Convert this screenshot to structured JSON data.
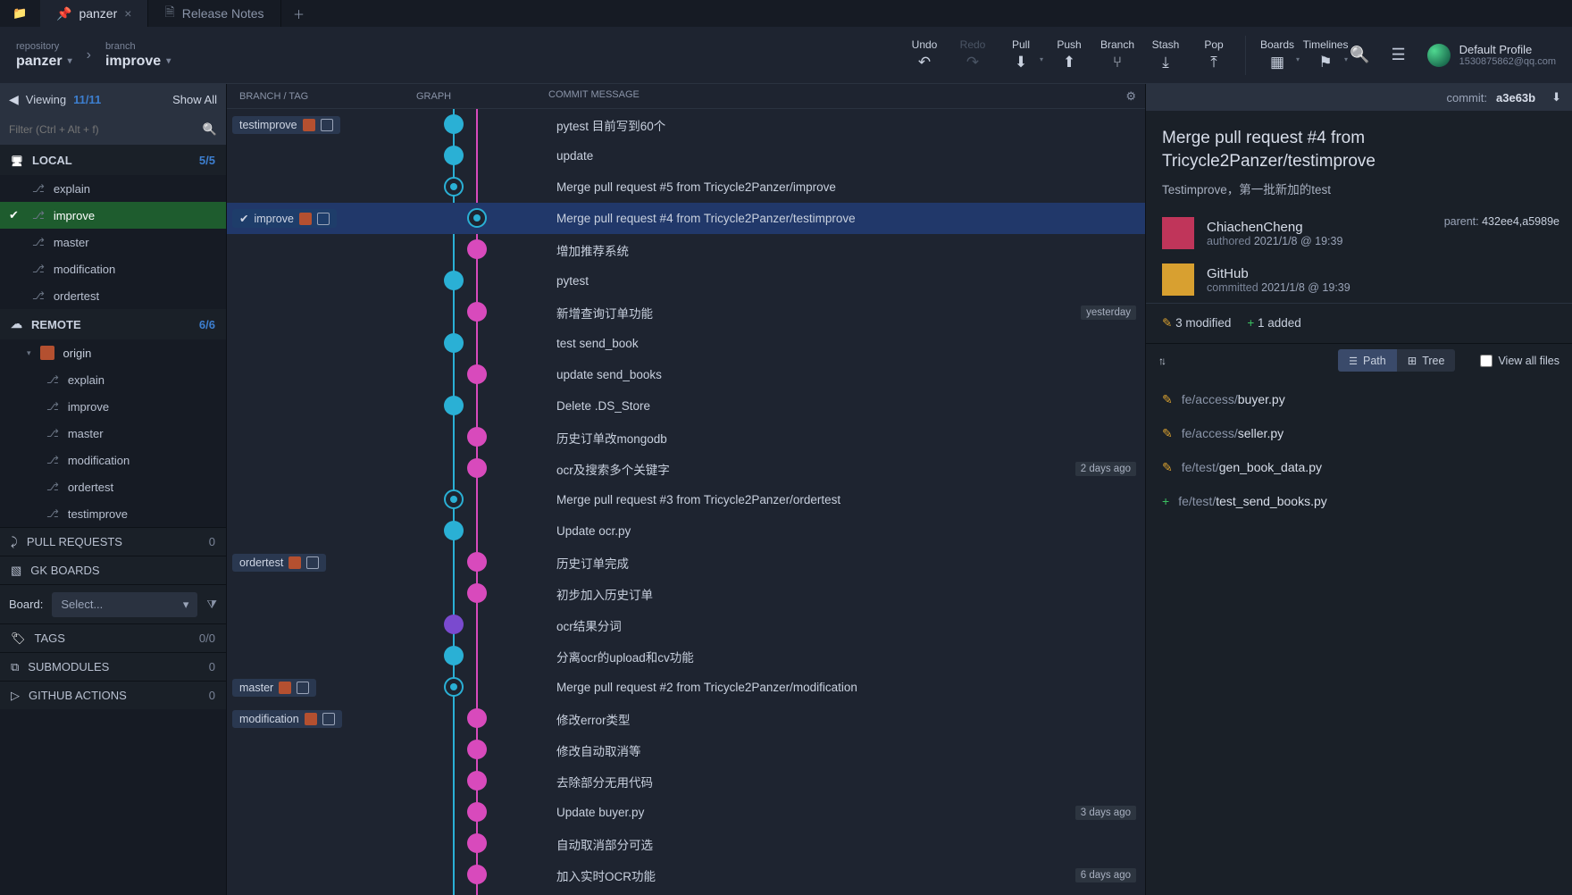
{
  "tabs": {
    "panzer": "panzer",
    "releaseNotes": "Release Notes"
  },
  "repo": {
    "label": "repository",
    "value": "panzer"
  },
  "branch": {
    "label": "branch",
    "value": "improve"
  },
  "actions": {
    "undo": "Undo",
    "redo": "Redo",
    "pull": "Pull",
    "push": "Push",
    "branch": "Branch",
    "stash": "Stash",
    "pop": "Pop",
    "boards": "Boards",
    "timelines": "Timelines"
  },
  "profile": {
    "name": "Default Profile",
    "email": "1530875862@qq.com"
  },
  "sidebar": {
    "viewing": "Viewing",
    "viewingCount": "11/11",
    "showAll": "Show All",
    "filterPlaceholder": "Filter (Ctrl + Alt + f)",
    "local": "LOCAL",
    "localCount": "5/5",
    "localBranches": [
      {
        "name": "explain"
      },
      {
        "name": "improve",
        "active": true
      },
      {
        "name": "master"
      },
      {
        "name": "modification"
      },
      {
        "name": "ordertest"
      }
    ],
    "remote": "REMOTE",
    "remoteCount": "6/6",
    "origin": "origin",
    "remoteBranches": [
      {
        "name": "explain"
      },
      {
        "name": "improve"
      },
      {
        "name": "master"
      },
      {
        "name": "modification"
      },
      {
        "name": "ordertest"
      },
      {
        "name": "testimprove"
      }
    ],
    "pullRequests": "PULL REQUESTS",
    "prCount": "0",
    "gkBoards": "GK BOARDS",
    "boardLabel": "Board:",
    "boardSelect": "Select...",
    "tags": "TAGS",
    "tagsCount": "0/0",
    "submodules": "SUBMODULES",
    "subCount": "0",
    "github": "GITHUB ACTIONS",
    "ghCount": "0"
  },
  "graphHeaders": {
    "branch": "BRANCH  /  TAG",
    "graph": "GRAPH",
    "message": "COMMIT MESSAGE"
  },
  "commits": [
    {
      "tag": "testimprove",
      "msg": "pytest 目前写到60个",
      "rail": 0,
      "type": "av"
    },
    {
      "msg": "update",
      "rail": 0,
      "type": "av"
    },
    {
      "msg": "Merge pull request #5 from Tricycle2Panzer/improve",
      "rail": 0,
      "type": "merge"
    },
    {
      "tag": "improve",
      "selected": true,
      "check": true,
      "msg": "Merge pull request #4 from Tricycle2Panzer/testimprove",
      "rail": 1,
      "type": "merge"
    },
    {
      "msg": "增加推荐系统",
      "rail": 1,
      "type": "av2"
    },
    {
      "msg": "pytest",
      "rail": 0,
      "type": "av"
    },
    {
      "msg": "新增查询订单功能",
      "rail": 1,
      "type": "av2",
      "date": "yesterday"
    },
    {
      "msg": "test send_book",
      "rail": 0,
      "type": "av"
    },
    {
      "msg": "update send_books",
      "rail": 1,
      "type": "av2"
    },
    {
      "msg": "Delete .DS_Store",
      "rail": 0,
      "type": "av"
    },
    {
      "msg": "历史订单改mongodb",
      "rail": 1,
      "type": "av2"
    },
    {
      "msg": "ocr及搜索多个关键字",
      "rail": 1,
      "type": "av2",
      "date": "2 days ago"
    },
    {
      "msg": "Merge pull request #3 from Tricycle2Panzer/ordertest",
      "rail": 0,
      "type": "merge"
    },
    {
      "msg": "Update ocr.py",
      "rail": 0,
      "type": "av"
    },
    {
      "tag": "ordertest",
      "msg": "历史订单完成",
      "rail": 1,
      "type": "av2"
    },
    {
      "msg": "初步加入历史订单",
      "rail": 1,
      "type": "av2"
    },
    {
      "msg": "ocr结果分词",
      "rail": 0,
      "type": "ava"
    },
    {
      "msg": "分离ocr的upload和cv功能",
      "rail": 0,
      "type": "av"
    },
    {
      "tag": "master",
      "msg": "Merge pull request #2 from Tricycle2Panzer/modification",
      "rail": 0,
      "type": "merge"
    },
    {
      "tag": "modification",
      "msg": "修改error类型",
      "rail": 1,
      "type": "av2"
    },
    {
      "msg": "修改自动取消等",
      "rail": 1,
      "type": "av2"
    },
    {
      "msg": "去除部分无用代码",
      "rail": 1,
      "type": "av2"
    },
    {
      "msg": "Update buyer.py",
      "rail": 1,
      "type": "av2",
      "date": "3 days ago"
    },
    {
      "msg": "自动取消部分可选",
      "rail": 1,
      "type": "av2"
    },
    {
      "msg": "加入实时OCR功能",
      "rail": 1,
      "type": "av2",
      "date": "6 days ago"
    }
  ],
  "detail": {
    "commitLabel": "commit:",
    "hash": "a3e63b",
    "title": "Merge pull request #4 from Tricycle2Panzer/testimprove",
    "subtitle": "Testimprove，第一批新加的test",
    "author": {
      "name": "ChiachenCheng",
      "role": "authored",
      "date": "2021/1/8 @ 19:39"
    },
    "committer": {
      "name": "GitHub",
      "role": "committed",
      "date": "2021/1/8 @ 19:39"
    },
    "parentLabel": "parent:",
    "parents": "432ee4,a5989e",
    "stats": {
      "modified": "3 modified",
      "added": "1 added"
    },
    "seg": {
      "path": "Path",
      "tree": "Tree"
    },
    "viewAll": "View all files",
    "files": [
      {
        "type": "mod",
        "dir": "fe/access/",
        "name": "buyer.py"
      },
      {
        "type": "mod",
        "dir": "fe/access/",
        "name": "seller.py"
      },
      {
        "type": "mod",
        "dir": "fe/test/",
        "name": "gen_book_data.py"
      },
      {
        "type": "add",
        "dir": "fe/test/",
        "name": "test_send_books.py"
      }
    ]
  }
}
